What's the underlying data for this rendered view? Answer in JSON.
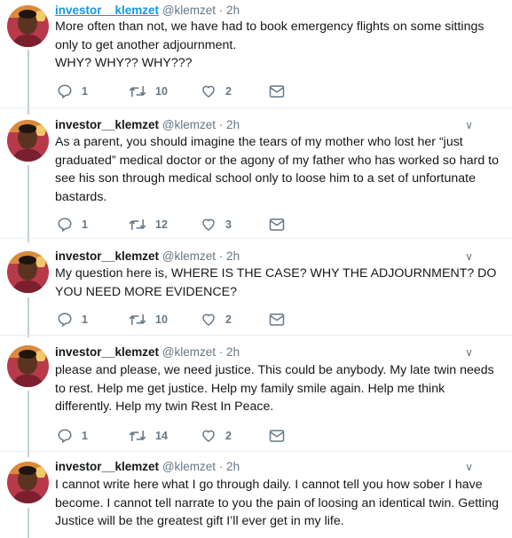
{
  "colors": {
    "link": "#1b95e0",
    "muted": "#657786",
    "text": "#14171a",
    "thread": "#c4cfd6"
  },
  "tweets": [
    {
      "name": "investor__klemzet",
      "handle": "@klemzet",
      "time": "· 2h",
      "text": "More often than not, we have had to book emergency flights on some sittings only to get another adjournment.\nWHY? WHY?? WHY???",
      "replies": "1",
      "retweets": "10",
      "likes": "2"
    },
    {
      "name": "investor__klemzet",
      "handle": "@klemzet",
      "time": "· 2h",
      "text": "As a parent, you should imagine the tears of my mother who lost her “just graduated” medical doctor or the agony of my father who has worked so hard to see his son through medical school only to loose him to a set of unfortunate bastards.",
      "replies": "1",
      "retweets": "12",
      "likes": "3"
    },
    {
      "name": "investor__klemzet",
      "handle": "@klemzet",
      "time": "· 2h",
      "text": "My question here is, WHERE IS THE CASE? WHY THE ADJOURNMENT? DO YOU NEED MORE EVIDENCE?",
      "replies": "1",
      "retweets": "10",
      "likes": "2"
    },
    {
      "name": "investor__klemzet",
      "handle": "@klemzet",
      "time": "· 2h",
      "text": "please and please, we need justice. This could be anybody. My late twin needs to rest. Help me get justice. Help my family smile again. Help me think differently. Help my twin Rest In Peace.",
      "replies": "1",
      "retweets": "14",
      "likes": "2"
    },
    {
      "name": "investor__klemzet",
      "handle": "@klemzet",
      "time": "· 2h",
      "text": "I cannot write here what I go through daily. I cannot tell you how sober I have become. I cannot tell narrate to you the pain of loosing an identical twin. Getting Justice will be the greatest gift I’ll ever get in my life."
    }
  ]
}
